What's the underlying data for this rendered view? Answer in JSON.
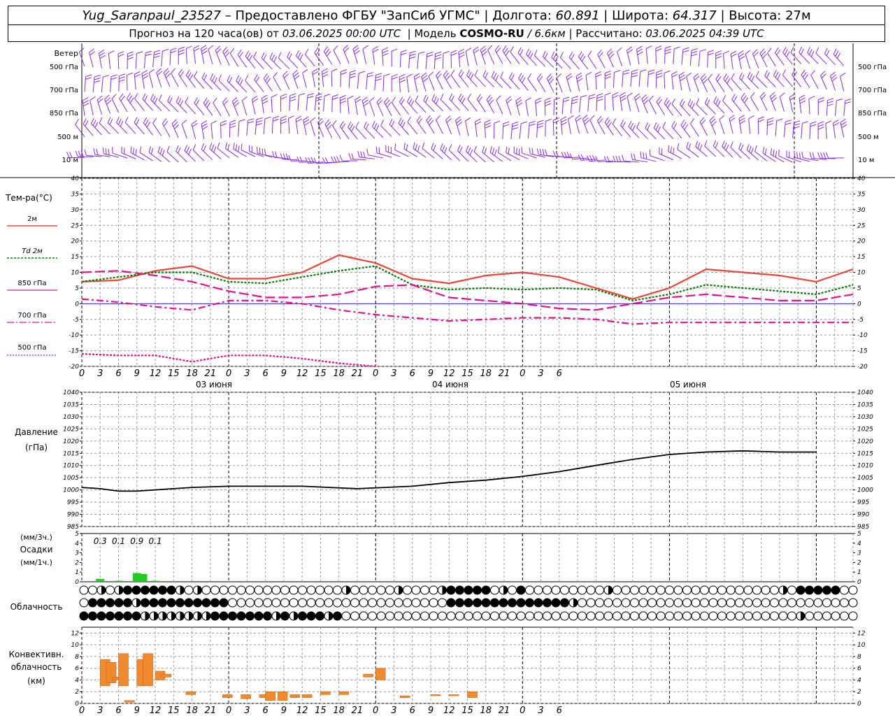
{
  "header": {
    "station": "Yug_Saranpaul_23527",
    "provided": "– Предоставлено ФГБУ \"ЗапСиб УГМС\"",
    "lon_label": "Долгота:",
    "lon": "60.891",
    "lat_label": "Широта:",
    "lat": "64.317",
    "alt_label": "Высота:",
    "alt": "27м",
    "forecast_prefix": "Прогноз на 120 часа(ов) от",
    "forecast_from": "03.06.2025 00:00 UTC",
    "model_label": "Модель",
    "model": "COSMO-RU",
    "model_res": "/ 6.6км",
    "calc_label": "Рассчитано:",
    "calc_time": "03.06.2025 04:39 UTC"
  },
  "colors": {
    "wind": "#8a2be2",
    "t2m": "#e8473a",
    "td2m": "#0a7a0a",
    "t850": "#e0148c",
    "t700": "#e0148c",
    "t500": "#e0148c",
    "precip": "#22cc22",
    "convective": "#f08a30",
    "pressure": "#000000"
  },
  "time_axis": {
    "ticks": [
      "0",
      "3",
      "6",
      "9",
      "12",
      "15",
      "18",
      "21",
      "0",
      "3",
      "6",
      "9",
      "12",
      "15",
      "18",
      "21",
      "0",
      "3",
      "6",
      "9",
      "12",
      "15",
      "18",
      "21",
      "0",
      "3",
      "6"
    ],
    "days": [
      "03 июня",
      "04 июня",
      "05 июня"
    ]
  },
  "wind_panel": {
    "title": "Ветер",
    "levels": [
      "500 гПа",
      "700 гПа",
      "850 гПа",
      "500 м",
      "10 м"
    ]
  },
  "temp_panel": {
    "title": "Тем-ра(°С)",
    "legend": [
      {
        "label": "2м",
        "style": "solid"
      },
      {
        "label": "Td 2м",
        "style": "dotted"
      },
      {
        "label": "850 гПа",
        "style": "solid-thin"
      },
      {
        "label": "700 гПа",
        "style": "dashdot"
      },
      {
        "label": "500 гПа",
        "style": "dotted-thin"
      }
    ],
    "yticks": [
      "40",
      "35",
      "30",
      "25",
      "20",
      "15",
      "10",
      "5",
      "0",
      "-5",
      "-10",
      "-15",
      "-20"
    ]
  },
  "pressure_panel": {
    "title": "Давление",
    "unit": "(гПа)",
    "yticks": [
      "1040",
      "1035",
      "1030",
      "1025",
      "1020",
      "1015",
      "1010",
      "1005",
      "1000",
      "995",
      "990",
      "985"
    ]
  },
  "precip_panel": {
    "unit_top": "(мм/3ч.)",
    "title": "Осадки",
    "unit_bottom": "(мм/1ч.)",
    "yticks": [
      "5",
      "4",
      "3",
      "2",
      "1",
      "0"
    ],
    "labels": [
      {
        "hour": 3,
        "text": "0.3"
      },
      {
        "hour": 6,
        "text": "0.1"
      },
      {
        "hour": 9,
        "text": "0.9"
      },
      {
        "hour": 12,
        "text": "0.1"
      }
    ]
  },
  "cloud_panel": {
    "title": "Облачность"
  },
  "conv_panel": {
    "title_1": "Конвективн.",
    "title_2": "облачность",
    "title_3": "(км)",
    "yticks": [
      "12",
      "10",
      "8",
      "6",
      "4",
      "2",
      "0"
    ]
  },
  "chart_data": [
    {
      "type": "line",
      "title": "Тем-ра(°С)",
      "x_hours": [
        0,
        6,
        12,
        18,
        24,
        30,
        36,
        42,
        48,
        54,
        60,
        66,
        72,
        78,
        84,
        90,
        96,
        102,
        108,
        114,
        120,
        126
      ],
      "ylim": [
        -20,
        40
      ],
      "series": [
        {
          "name": "2м",
          "values": [
            7,
            7.5,
            10.5,
            12,
            8,
            8,
            10,
            15.5,
            13,
            8,
            6.5,
            9,
            10,
            8.5,
            5,
            1.5,
            5,
            11,
            10,
            9,
            7,
            11
          ]
        },
        {
          "name": "Td 2м",
          "values": [
            7,
            8.5,
            10,
            10,
            7,
            6.5,
            8.5,
            10.5,
            12,
            6,
            4.5,
            5,
            4.5,
            5,
            4.5,
            1,
            3,
            6,
            5,
            4,
            3,
            6
          ]
        },
        {
          "name": "850 гПа",
          "values": [
            10,
            10.5,
            9,
            7,
            4,
            2,
            2,
            3,
            5.5,
            6,
            2,
            1,
            0,
            -1.5,
            -2,
            0,
            2,
            3,
            2,
            1,
            1,
            3
          ]
        },
        {
          "name": "700 гПа",
          "values": [
            1.5,
            0.5,
            -1,
            -2,
            1,
            1,
            0,
            -2,
            -3.5,
            -4.5,
            -5.5,
            -5,
            -4.5,
            -4.5,
            -5,
            -6.5,
            -6,
            -6,
            -6,
            -6,
            -6,
            -6
          ]
        },
        {
          "name": "500 гПа",
          "values": [
            -16,
            -16.5,
            -16.5,
            -18.5,
            -16.5,
            -16.5,
            -17.5,
            -19,
            -21,
            null,
            null,
            null,
            null,
            null,
            null,
            null,
            null,
            null,
            null,
            null,
            null,
            null
          ]
        }
      ]
    },
    {
      "type": "line",
      "title": "Давление",
      "x_hours": [
        0,
        3,
        6,
        9,
        12,
        18,
        24,
        36,
        45,
        54,
        60,
        66,
        72,
        78,
        84,
        90,
        96,
        102,
        108,
        114,
        120
      ],
      "ylim": [
        985,
        1040
      ],
      "series": [
        {
          "name": "Давление",
          "values": [
            1001,
            1000.5,
            999.5,
            999.5,
            1000,
            1001,
            1001.5,
            1001.5,
            1000.5,
            1001.5,
            1003,
            1004,
            1005.5,
            1007.5,
            1010,
            1012.5,
            1014.5,
            1015.5,
            1016,
            1015.5,
            1015.5
          ]
        }
      ]
    },
    {
      "type": "bar",
      "title": "Осадки",
      "x_hours": [
        3,
        6,
        9,
        10,
        12
      ],
      "ylim": [
        0,
        5
      ],
      "values": [
        0.3,
        0.1,
        0.9,
        0.8,
        0.1
      ]
    },
    {
      "type": "bar",
      "title": "Конвективн. облачность (км)",
      "ylim": [
        0,
        12
      ],
      "segments": [
        {
          "hour": 3,
          "base": 3,
          "top": 7.5
        },
        {
          "hour": 4,
          "base": 3.5,
          "top": 7
        },
        {
          "hour": 5,
          "base": 4,
          "top": 4.5
        },
        {
          "hour": 6,
          "base": 3,
          "top": 8.5
        },
        {
          "hour": 7,
          "base": 0.2,
          "top": 0.5
        },
        {
          "hour": 9,
          "base": 3,
          "top": 7.5
        },
        {
          "hour": 10,
          "base": 3,
          "top": 8.5
        },
        {
          "hour": 12,
          "base": 4,
          "top": 5.5
        },
        {
          "hour": 13,
          "base": 4.5,
          "top": 5
        },
        {
          "hour": 17,
          "base": 1.5,
          "top": 2
        },
        {
          "hour": 23,
          "base": 1,
          "top": 1.5
        },
        {
          "hour": 26,
          "base": 0.8,
          "top": 1.5
        },
        {
          "hour": 29,
          "base": 1,
          "top": 1.5
        },
        {
          "hour": 30,
          "base": 0.5,
          "top": 2
        },
        {
          "hour": 32,
          "base": 0.5,
          "top": 2
        },
        {
          "hour": 34,
          "base": 1,
          "top": 1.5
        },
        {
          "hour": 36,
          "base": 1,
          "top": 1.5
        },
        {
          "hour": 39,
          "base": 1.5,
          "top": 2
        },
        {
          "hour": 42,
          "base": 1.5,
          "top": 2
        },
        {
          "hour": 46,
          "base": 4.5,
          "top": 5
        },
        {
          "hour": 48,
          "base": 4,
          "top": 6
        },
        {
          "hour": 52,
          "base": 1,
          "top": 1.3
        },
        {
          "hour": 57,
          "base": 1.3,
          "top": 1.5
        },
        {
          "hour": 60,
          "base": 1.3,
          "top": 1.5
        },
        {
          "hour": 63,
          "base": 1,
          "top": 2
        }
      ]
    }
  ]
}
